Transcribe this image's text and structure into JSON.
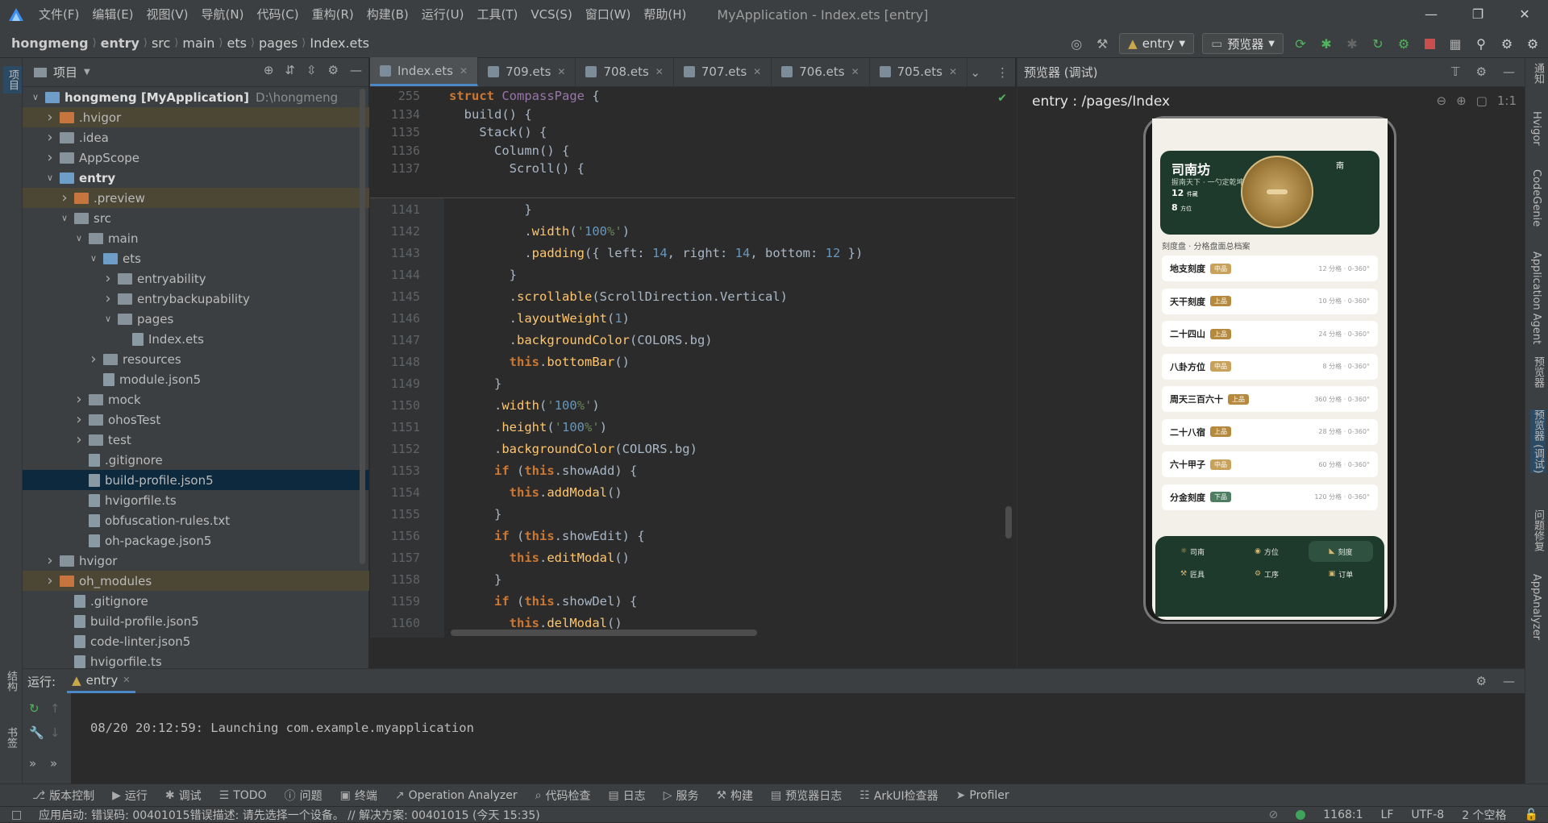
{
  "titlebar": {
    "menus": [
      "文件(F)",
      "编辑(E)",
      "视图(V)",
      "导航(N)",
      "代码(C)",
      "重构(R)",
      "构建(B)",
      "运行(U)",
      "工具(T)",
      "VCS(S)",
      "窗口(W)",
      "帮助(H)"
    ],
    "window_title": "MyApplication - Index.ets [entry]"
  },
  "breadcrumbs": [
    "hongmeng",
    "entry",
    "src",
    "main",
    "ets",
    "pages",
    "Index.ets"
  ],
  "toolbar": {
    "module": "entry",
    "previewer": "预览器"
  },
  "project": {
    "title": "项目",
    "tree": [
      {
        "label": "hongmeng [MyApplication]",
        "extra": "D:\\hongmeng",
        "depth": 0,
        "arrow": "down",
        "icon": "blue"
      },
      {
        "label": ".hvigor",
        "depth": 1,
        "arrow": "right",
        "icon": "orange",
        "hl": true
      },
      {
        "label": ".idea",
        "depth": 1,
        "arrow": "right",
        "icon": "gray"
      },
      {
        "label": "AppScope",
        "depth": 1,
        "arrow": "right",
        "icon": "gray"
      },
      {
        "label": "entry",
        "depth": 1,
        "arrow": "down",
        "icon": "blue",
        "bold": true
      },
      {
        "label": ".preview",
        "depth": 2,
        "arrow": "right",
        "icon": "orange",
        "hl": true
      },
      {
        "label": "src",
        "depth": 2,
        "arrow": "down",
        "icon": "gray"
      },
      {
        "label": "main",
        "depth": 3,
        "arrow": "down",
        "icon": "gray"
      },
      {
        "label": "ets",
        "depth": 4,
        "arrow": "down",
        "icon": "blue"
      },
      {
        "label": "entryability",
        "depth": 5,
        "arrow": "right",
        "icon": "gray"
      },
      {
        "label": "entrybackupability",
        "depth": 5,
        "arrow": "right",
        "icon": "gray"
      },
      {
        "label": "pages",
        "depth": 5,
        "arrow": "down",
        "icon": "gray"
      },
      {
        "label": "Index.ets",
        "depth": 6,
        "arrow": "",
        "icon": "file"
      },
      {
        "label": "resources",
        "depth": 4,
        "arrow": "right",
        "icon": "gray"
      },
      {
        "label": "module.json5",
        "depth": 4,
        "arrow": "",
        "icon": "file"
      },
      {
        "label": "mock",
        "depth": 3,
        "arrow": "right",
        "icon": "gray"
      },
      {
        "label": "ohosTest",
        "depth": 3,
        "arrow": "right",
        "icon": "gray"
      },
      {
        "label": "test",
        "depth": 3,
        "arrow": "right",
        "icon": "gray"
      },
      {
        "label": ".gitignore",
        "depth": 3,
        "arrow": "",
        "icon": "file"
      },
      {
        "label": "build-profile.json5",
        "depth": 3,
        "arrow": "",
        "icon": "file",
        "sel": true
      },
      {
        "label": "hvigorfile.ts",
        "depth": 3,
        "arrow": "",
        "icon": "file"
      },
      {
        "label": "obfuscation-rules.txt",
        "depth": 3,
        "arrow": "",
        "icon": "file"
      },
      {
        "label": "oh-package.json5",
        "depth": 3,
        "arrow": "",
        "icon": "file"
      },
      {
        "label": "hvigor",
        "depth": 1,
        "arrow": "right",
        "icon": "gray"
      },
      {
        "label": "oh_modules",
        "depth": 1,
        "arrow": "right",
        "icon": "orange",
        "hl": true
      },
      {
        "label": ".gitignore",
        "depth": 2,
        "arrow": "",
        "icon": "file"
      },
      {
        "label": "build-profile.json5",
        "depth": 2,
        "arrow": "",
        "icon": "file"
      },
      {
        "label": "code-linter.json5",
        "depth": 2,
        "arrow": "",
        "icon": "file"
      },
      {
        "label": "hvigorfile.ts",
        "depth": 2,
        "arrow": "",
        "icon": "file"
      }
    ]
  },
  "editor": {
    "tabs": [
      "Index.ets",
      "709.ets",
      "708.ets",
      "707.ets",
      "706.ets",
      "705.ets"
    ],
    "lines": [
      {
        "n": "255",
        "t": "struct CompassPage {"
      },
      {
        "n": "1134",
        "t": "  build() {"
      },
      {
        "n": "1135",
        "t": "    Stack() {"
      },
      {
        "n": "1136",
        "t": "      Column() {"
      },
      {
        "n": "1137",
        "t": "        Scroll() {"
      },
      {
        "n": "1141",
        "t": "          }"
      },
      {
        "n": "1142",
        "t": "          .width('100%')"
      },
      {
        "n": "1143",
        "t": "          .padding({ left: 14, right: 14, bottom: 12 })"
      },
      {
        "n": "1144",
        "t": "        }"
      },
      {
        "n": "1145",
        "t": "        .scrollable(ScrollDirection.Vertical)"
      },
      {
        "n": "1146",
        "t": "        .layoutWeight(1)"
      },
      {
        "n": "1147",
        "t": "        .backgroundColor(COLORS.bg)"
      },
      {
        "n": "1148",
        "t": "        this.bottomBar()"
      },
      {
        "n": "1149",
        "t": "      }"
      },
      {
        "n": "1150",
        "t": "      .width('100%')"
      },
      {
        "n": "1151",
        "t": "      .height('100%')"
      },
      {
        "n": "1152",
        "t": "      .backgroundColor(COLORS.bg)"
      },
      {
        "n": "1153",
        "t": "      if (this.showAdd) {"
      },
      {
        "n": "1154",
        "t": "        this.addModal()"
      },
      {
        "n": "1155",
        "t": "      }"
      },
      {
        "n": "1156",
        "t": "      if (this.showEdit) {"
      },
      {
        "n": "1157",
        "t": "        this.editModal()"
      },
      {
        "n": "1158",
        "t": "      }"
      },
      {
        "n": "1159",
        "t": "      if (this.showDel) {"
      },
      {
        "n": "1160",
        "t": "        this.delModal()"
      }
    ]
  },
  "preview": {
    "header": "预览器 (调试)",
    "path": "entry : /pages/Index",
    "app": {
      "brand": "司南坊",
      "slogan": "握南天下 · 一勺定乾坤",
      "stat1_num": "12",
      "stat1_label": "件藏",
      "stat2_num": "8",
      "stat2_label": "方位",
      "compass_south": "南",
      "section": "刻度盘 · 分格盘面总档案",
      "items": [
        {
          "name": "地支刻度",
          "tag": "中品",
          "meta": "12 分格 · 0-360°"
        },
        {
          "name": "天干刻度",
          "tag": "上品",
          "meta": "10 分格 · 0-360°"
        },
        {
          "name": "二十四山",
          "tag": "上品",
          "meta": "24 分格 · 0-360°"
        },
        {
          "name": "八卦方位",
          "tag": "中品",
          "meta": "8 分格 · 0-360°"
        },
        {
          "name": "周天三百六十",
          "tag": "上品",
          "meta": "360 分格 · 0-360°"
        },
        {
          "name": "二十八宿",
          "tag": "上品",
          "meta": "28 分格 · 0-360°"
        },
        {
          "name": "六十甲子",
          "tag": "中品",
          "meta": "60 分格 · 0-360°"
        },
        {
          "name": "分金刻度",
          "tag": "下品",
          "meta": "120 分格 · 0-360°"
        }
      ],
      "nav": [
        "司南",
        "方位",
        "刻度",
        "匠具",
        "工序",
        "订单"
      ]
    }
  },
  "run": {
    "label": "运行:",
    "tab": "entry",
    "log": "08/20 20:12:59: Launching com.example.myapplication"
  },
  "bottom_tools": [
    "版本控制",
    "运行",
    "调试",
    "TODO",
    "问题",
    "终端",
    "Operation Analyzer",
    "代码检查",
    "日志",
    "服务",
    "构建",
    "预览器日志",
    "ArkUI检查器",
    "Profiler"
  ],
  "status": {
    "message": "应用启动: 错误码: 00401015错误描述: 请先选择一个设备。 // 解决方案: 00401015 (今天 15:35)",
    "position": "1168:1",
    "line_sep": "LF",
    "encoding": "UTF-8",
    "indent": "2 个空格"
  },
  "left_strip": [
    "项目",
    "结构",
    "书签"
  ],
  "right_strip": [
    "通知",
    "Hvigor",
    "CodeGenie",
    "Application Agent",
    "预览器",
    "预览器 (调试)",
    "问题修复",
    "AppAnalyzer"
  ]
}
